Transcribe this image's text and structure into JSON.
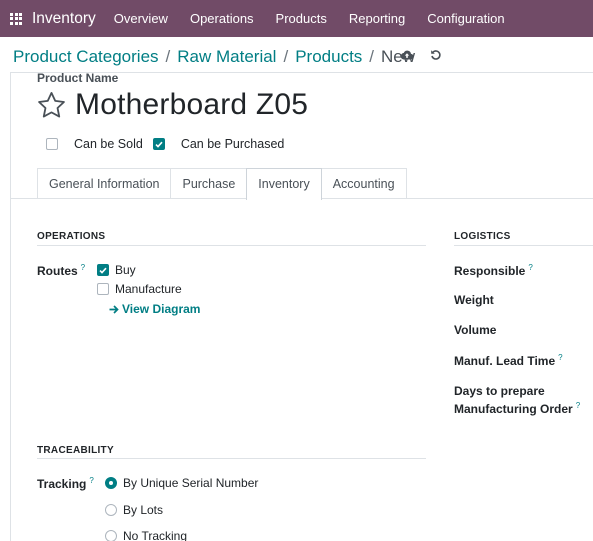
{
  "navbar": {
    "app_name": "Inventory",
    "menu": [
      "Overview",
      "Operations",
      "Products",
      "Reporting",
      "Configuration"
    ]
  },
  "breadcrumb": {
    "items": [
      "Product Categories",
      "Raw Material",
      "Products"
    ],
    "current": "New"
  },
  "product": {
    "name_label": "Product Name",
    "name": "Motherboard Z05",
    "can_be_sold": {
      "label": "Can be Sold",
      "checked": false
    },
    "can_be_purchased": {
      "label": "Can be Purchased",
      "checked": true
    }
  },
  "tabs": [
    {
      "label": "General Information",
      "active": false
    },
    {
      "label": "Purchase",
      "active": false
    },
    {
      "label": "Inventory",
      "active": true
    },
    {
      "label": "Accounting",
      "active": false
    }
  ],
  "operations": {
    "title": "OPERATIONS",
    "routes_label": "Routes",
    "routes": [
      {
        "label": "Buy",
        "checked": true
      },
      {
        "label": "Manufacture",
        "checked": false
      }
    ],
    "view_diagram": "View Diagram"
  },
  "logistics": {
    "title": "LOGISTICS",
    "fields": {
      "responsible": "Responsible",
      "weight": "Weight",
      "volume": "Volume",
      "manuf_lead_time": "Manuf. Lead Time",
      "days_to_prepare_line1": "Days to prepare",
      "days_to_prepare_line2": "Manufacturing Order"
    }
  },
  "traceability": {
    "title": "TRACEABILITY",
    "tracking_label": "Tracking",
    "options": [
      {
        "label": "By Unique Serial Number",
        "selected": true
      },
      {
        "label": "By Lots",
        "selected": false
      },
      {
        "label": "No Tracking",
        "selected": false
      }
    ]
  },
  "help_marker": "?",
  "colors": {
    "navbar": "#714b67",
    "accent": "#017e84"
  }
}
